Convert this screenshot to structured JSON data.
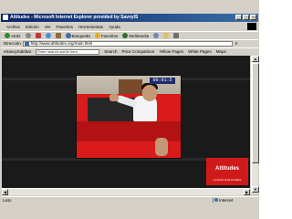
{
  "window": {
    "title": "Attitudes - Microsoft Internet Explorer provided by SavvyIS"
  },
  "menu": [
    "Archivo",
    "Edición",
    "Ver",
    "Favoritos",
    "Herramientas",
    "Ayuda"
  ],
  "toolbar": {
    "back": "Atrás",
    "search": "Búsqueda",
    "favorites": "Favoritos",
    "media": "Multimedia"
  },
  "address": {
    "label": "Dirección",
    "url": "http://www.attitudes.org/main.html",
    "go": "Ir"
  },
  "searchbar": {
    "brand": "eSavvySidebar",
    "placeholder": "Enter search words here",
    "search": "Search",
    "price": "Price Comparison",
    "yellow": "Yellow Pages",
    "white": "White Pages",
    "maps": "Maps"
  },
  "video": {
    "timecode": "00:01:5"
  },
  "brand": {
    "name": "Attitudes",
    "tagline": "Conducta social de Madrid"
  },
  "status": {
    "text": "Listo",
    "zone": "Internet"
  },
  "colors": {
    "accent": "#d01a1a",
    "titlebar": "#0a246a"
  }
}
